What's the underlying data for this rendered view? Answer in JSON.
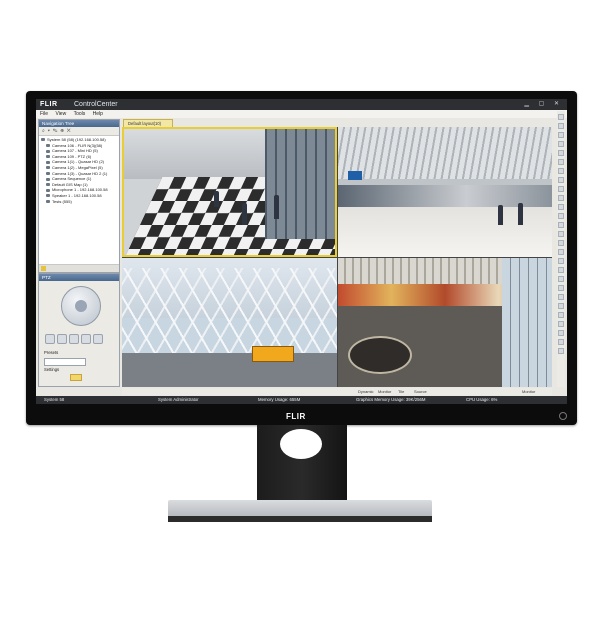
{
  "app": {
    "logo": "FLIR",
    "title": "ControlCenter"
  },
  "menu": [
    "File",
    "View",
    "Tools",
    "Help"
  ],
  "nav": {
    "title": "Navigation Tree",
    "items": [
      "System 58 (58) (192.168.100.58)",
      "Camera 106 - FLIR N(3)(58)",
      "Camera 107 - Mini HD (5)",
      "Camera 109 - PTZ (6)",
      "Camera 1(1) - Quasar HD (2)",
      "Camera 1(2) - MegaPixel (5)",
      "Camera 1(3) - Quasar HD 2 (1)",
      "Camera Sequence (1)",
      "Default GIS Map (1)",
      "Microphone 1 - 192.168.100.58",
      "Speaker 1 - 192.168.100.58",
      "Tests (555)"
    ]
  },
  "ptz": {
    "title": "PTZ",
    "presets_label": "Presets",
    "settings_label": "Settings"
  },
  "layout": {
    "tab_label": "Default layout(10)"
  },
  "bottom": {
    "dynamic": "Dynamic",
    "monitor": "Monitor",
    "tile": "Tile",
    "source": "Source",
    "monitor2": "Monitor"
  },
  "status": {
    "system": "System 58",
    "user": "System Administrator",
    "memory": "Memory Usage: 655M",
    "graphics": "Graphics Memory Usage: 39K/256M",
    "cpu": "CPU Usage: 6%"
  },
  "bezel": {
    "logo": "FLIR"
  }
}
